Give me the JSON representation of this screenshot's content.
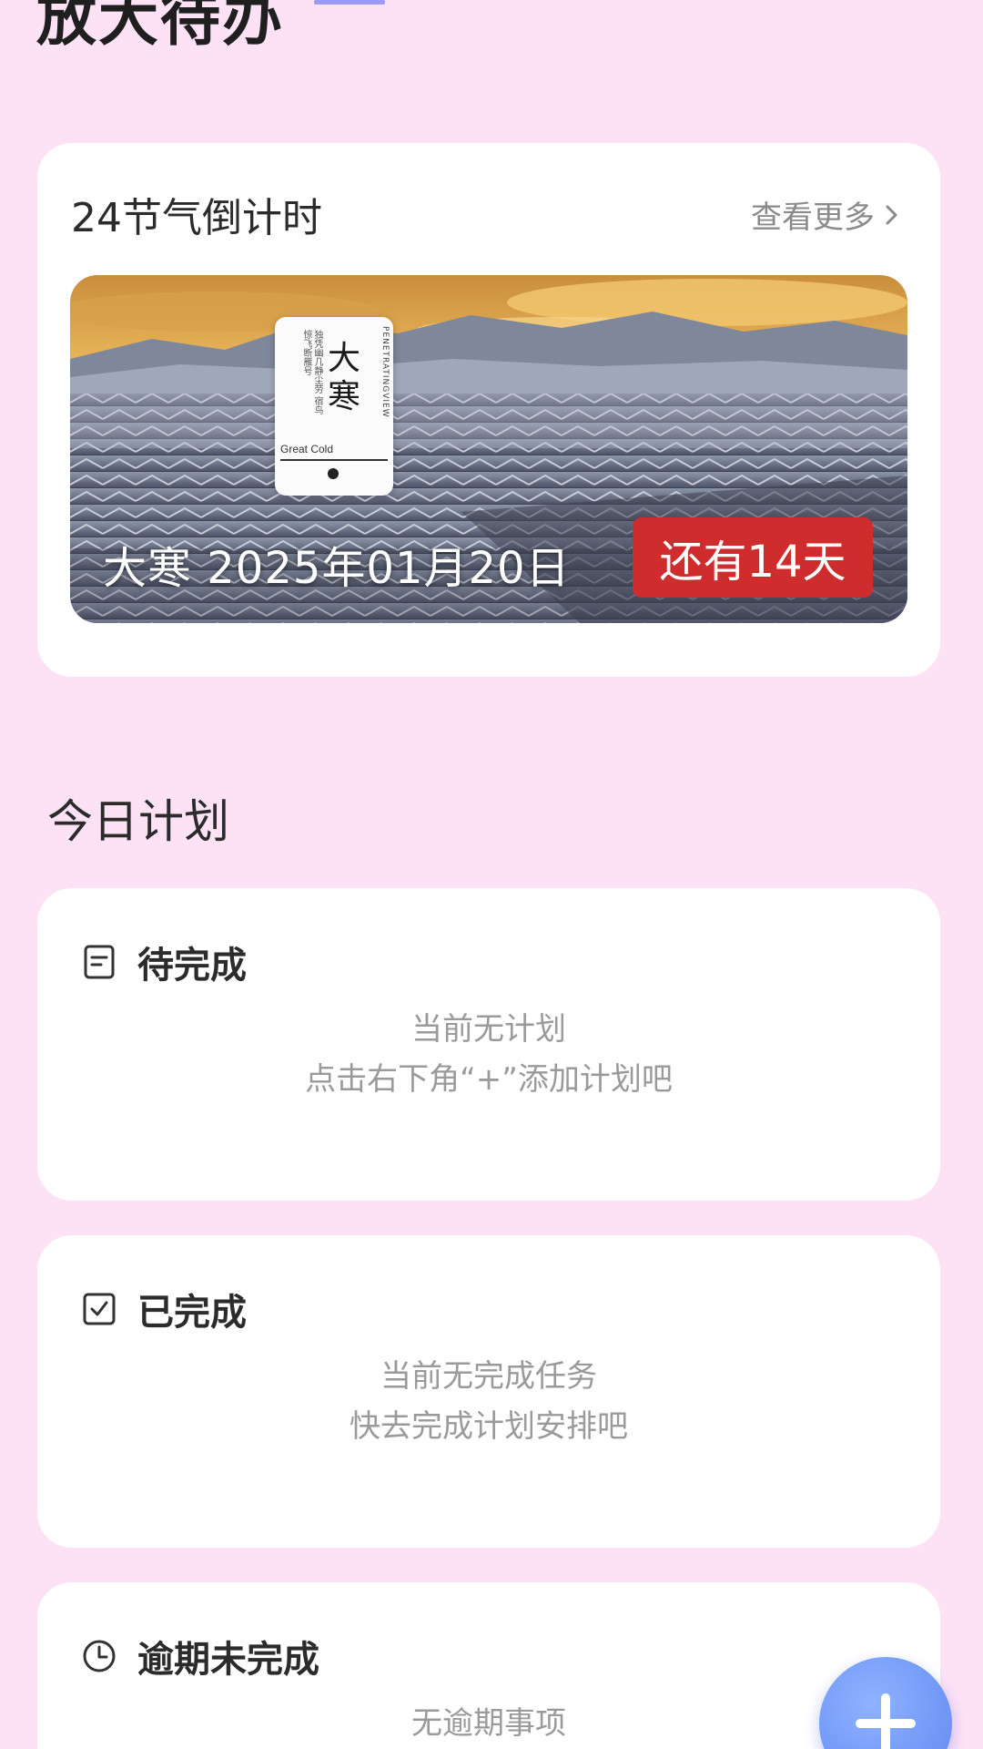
{
  "header": {
    "app_title": "放大待办"
  },
  "jieqi_card": {
    "title": "24节气倒计时",
    "more_label": "查看更多",
    "banner": {
      "term_chars": [
        "大",
        "寒"
      ],
      "poem": "独凭幽几静尘劳 宿鸟惊飞断雁号",
      "poster_side_text": "PENETRATINGVIEW",
      "poster_en": "Great Cold",
      "date_text": "大寒  2025年01月20日",
      "countdown_text": "还有14天"
    }
  },
  "today_plan": {
    "section_title": "今日计划",
    "pending": {
      "label": "待完成",
      "icon": "note-icon",
      "empty_line1": "当前无计划",
      "empty_line2": "点击右下角“+”添加计划吧"
    },
    "done": {
      "label": "已完成",
      "icon": "check-square-icon",
      "empty_line1": "当前无完成任务",
      "empty_line2": "快去完成计划安排吧"
    },
    "overdue": {
      "label": "逾期未完成",
      "icon": "clock-icon",
      "empty_line1": "无逾期事项"
    }
  },
  "fab": {
    "icon": "plus-icon"
  },
  "colors": {
    "background": "#fde2f6",
    "card": "#ffffff",
    "badge": "#cf2d2d",
    "fab": "#6f95f6"
  }
}
